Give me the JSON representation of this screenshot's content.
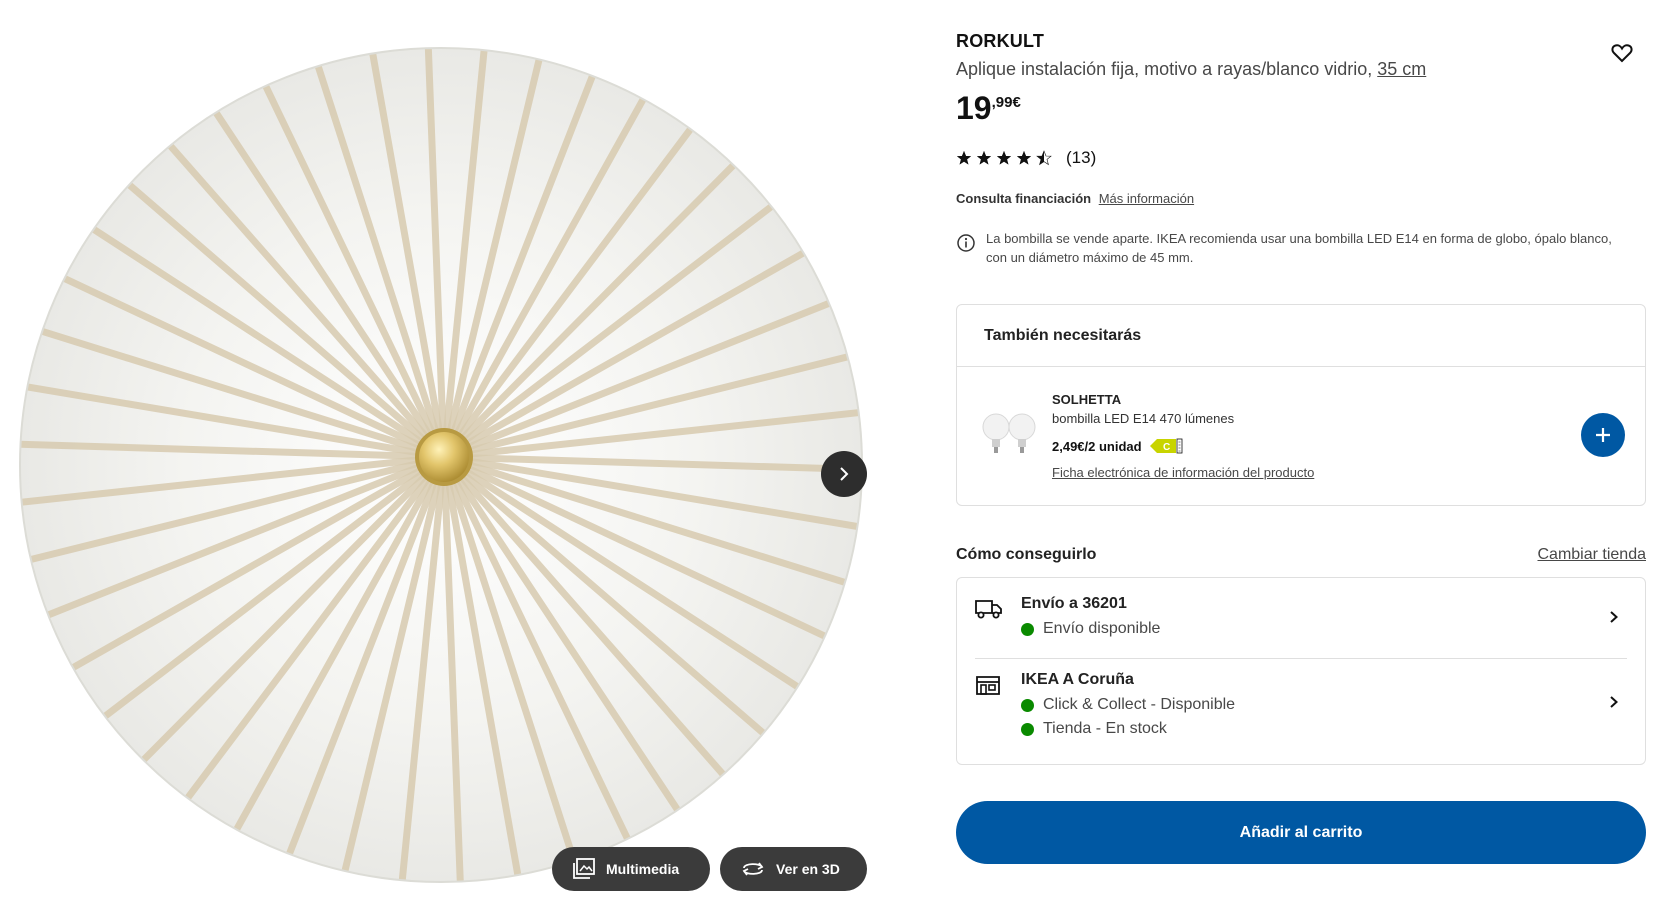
{
  "gallery": {
    "image_alt": "",
    "buttons": {
      "multimedia": "Multimedia",
      "view3d": "Ver en 3D"
    },
    "icons": {
      "next": "chevron-right-icon",
      "multimedia": "image-gallery-icon",
      "view3d": "rotate-3d-icon"
    }
  },
  "product": {
    "name": "RORKULT",
    "description": "Aplique instalación fija, motivo a rayas/blanco vidrio,",
    "size": "35 cm",
    "price_int": "19",
    "price_dec": ",99€",
    "rating_value": 4.5,
    "rating_max": 5,
    "rating_count": "(13)"
  },
  "finance": {
    "label": "Consulta financiación",
    "link": "Más información"
  },
  "notice": {
    "icon": "info-icon",
    "text": "La bombilla se vende aparte. IKEA recomienda usar una bombilla LED E14 en forma de globo, ópalo blanco, con un diámetro máximo de 45 mm."
  },
  "also_need": {
    "title": "También necesitarás",
    "item": {
      "name": "SOLHETTA",
      "description": "bombilla LED E14 470 lúmenes",
      "price": "2,49€/2 unidad",
      "energy_class": "C",
      "sheet_link": "Ficha electrónica de información del producto"
    }
  },
  "delivery": {
    "title": "Cómo conseguirlo",
    "change_store": "Cambiar tienda",
    "shipping": {
      "title": "Envío a 36201",
      "status": "Envío disponible"
    },
    "store": {
      "title": "IKEA A Coruña",
      "status1": "Click & Collect - Disponible",
      "status2": "Tienda - En stock"
    },
    "status_color": "#0a8a00"
  },
  "cart": {
    "label": "Añadir al carrito",
    "color": "#0058a3"
  }
}
